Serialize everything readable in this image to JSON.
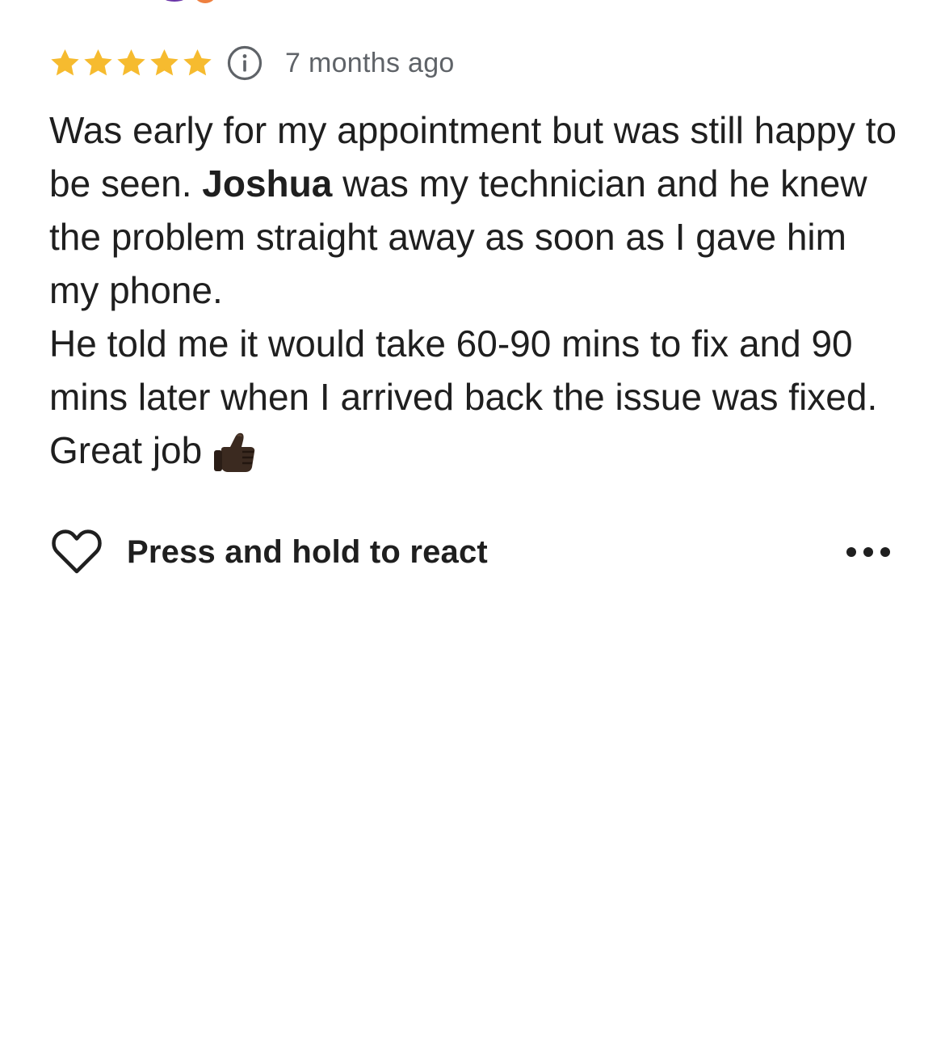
{
  "review": {
    "rating": 5,
    "rating_max": 5,
    "time_ago": "7 months ago",
    "body": {
      "line1": "Was early for my appointment but was still happy to be seen. ",
      "name": "Joshua",
      "line2": " was my technician and he knew the problem straight away as soon as I gave him my phone.",
      "line3": "He told me it would take 60-90 mins to fix and 90 mins later when I arrived back the issue was fixed. Great job"
    }
  },
  "actions": {
    "react_label": "Press and hold to react"
  },
  "icons": {
    "star": "star-icon",
    "info": "info-icon",
    "heart": "heart-icon",
    "more": "more-horizontal-icon",
    "thumbs_up": "thumbs-up-emoji"
  },
  "colors": {
    "star": "#f6bb2f",
    "muted_text": "#5f6368",
    "text": "#1f1f1f"
  }
}
